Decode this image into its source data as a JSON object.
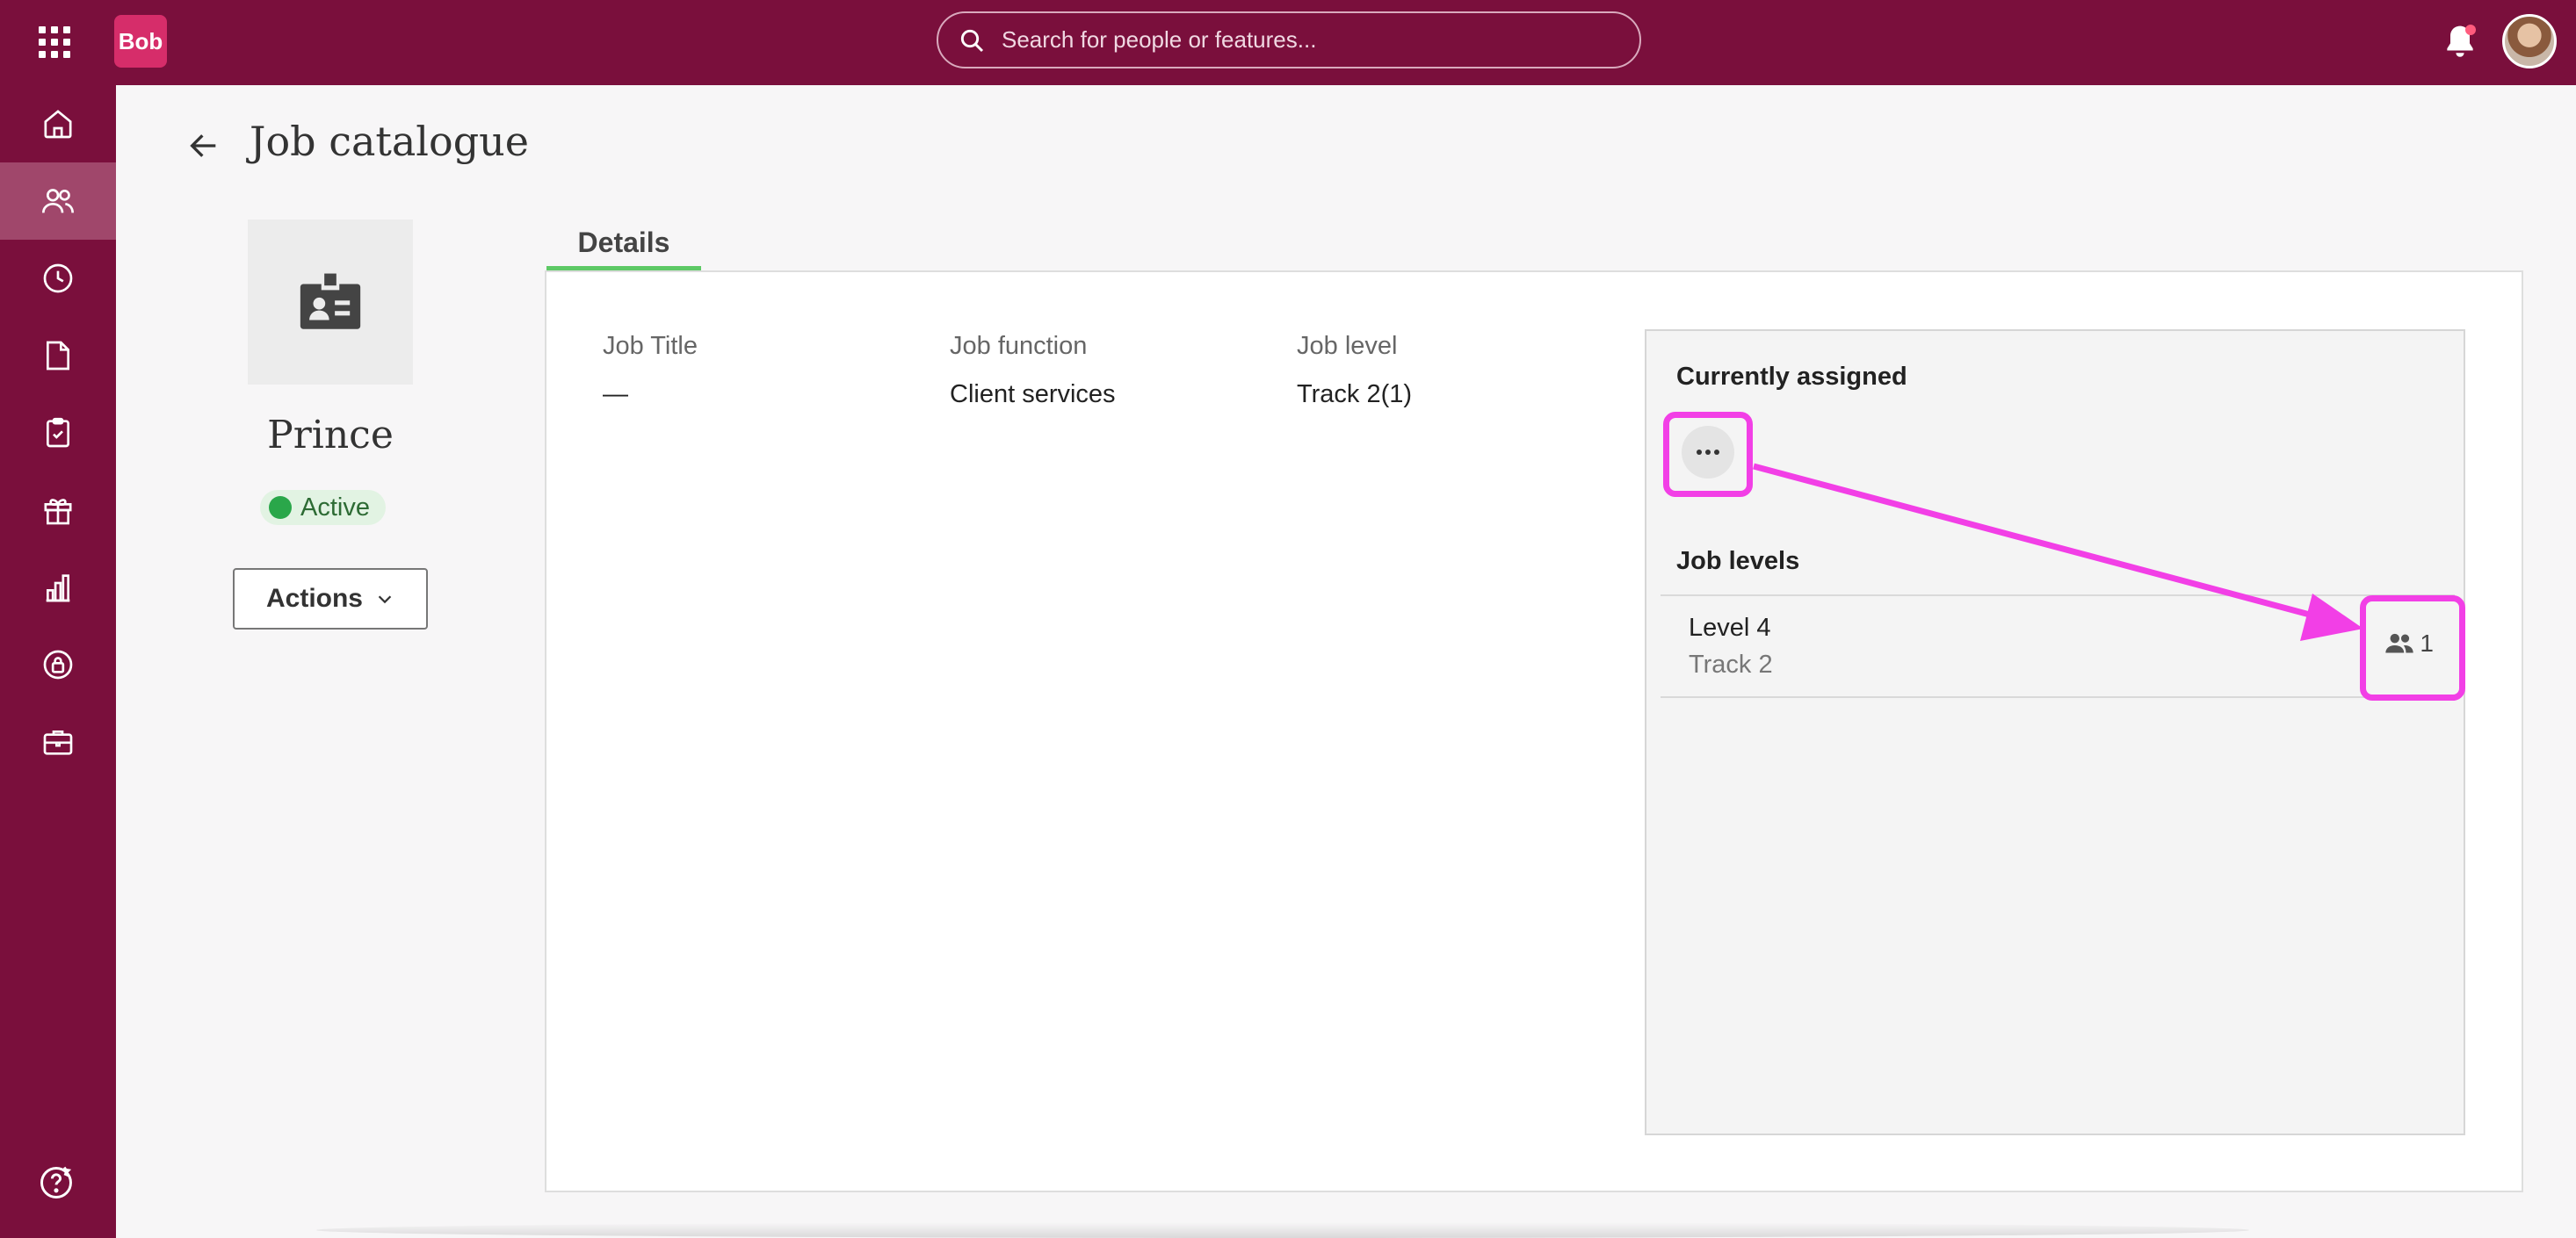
{
  "topbar": {
    "logo_text": "Bob",
    "search_placeholder": "Search for people or features...",
    "brand_color": "#7a0f3c",
    "accent_color": "#d62d6a"
  },
  "sidebar": {
    "items": [
      {
        "icon": "home-icon"
      },
      {
        "icon": "people-icon",
        "active": true
      },
      {
        "icon": "clock-icon"
      },
      {
        "icon": "document-icon"
      },
      {
        "icon": "clipboard-check-icon"
      },
      {
        "icon": "gift-icon"
      },
      {
        "icon": "bar-chart-icon"
      },
      {
        "icon": "lock-icon"
      },
      {
        "icon": "briefcase-icon"
      }
    ],
    "help_icon": "help-icon"
  },
  "header": {
    "title": "Job catalogue"
  },
  "profile": {
    "name": "Prince",
    "status": "Active",
    "status_color": "#2aa74a",
    "actions_label": "Actions"
  },
  "tabs": [
    {
      "label": "Details",
      "active": true
    }
  ],
  "details": {
    "fields": [
      {
        "label": "Job Title",
        "value": "—"
      },
      {
        "label": "Job function",
        "value": "Client services"
      },
      {
        "label": "Job level",
        "value": "Track 2(1)"
      }
    ]
  },
  "assigned": {
    "title": "Currently assigned",
    "levels_title": "Job levels",
    "levels": [
      {
        "name": "Level 4",
        "track": "Track 2",
        "count": "1"
      }
    ]
  },
  "annotation_color": "#f23fe6"
}
